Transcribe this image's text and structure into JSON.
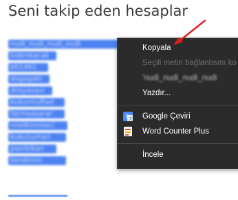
{
  "page": {
    "title": "Seni takip eden hesaplar"
  },
  "list": {
    "items": [
      "nudi_nudi_nudi_nudi",
      "kidenkacak",
      "bh1461",
      "dogagaki",
      "dosyasavi",
      "kukurmuftad",
      "fatmaasarar",
      "nnelkimmeci",
      "kukuzumari",
      "psorbikan",
      "kendimin"
    ]
  },
  "context_menu": {
    "copy_label": "Kopyala",
    "selection_link_label": "Seçili metin bağlantısını ko",
    "search_label": "'nudi_nudi_nudi_nudi",
    "print_label": "Yazdır...",
    "google_translate_label": "Google Çeviri",
    "word_counter_label": "Word Counter Plus",
    "inspect_label": "İncele"
  },
  "colors": {
    "menu_background": "#2b2b2b",
    "selection": "#2f6df0",
    "annotation_arrow": "#e02020"
  },
  "icons": {
    "google_translate": "google-translate-icon",
    "word_counter": "word-counter-icon"
  }
}
